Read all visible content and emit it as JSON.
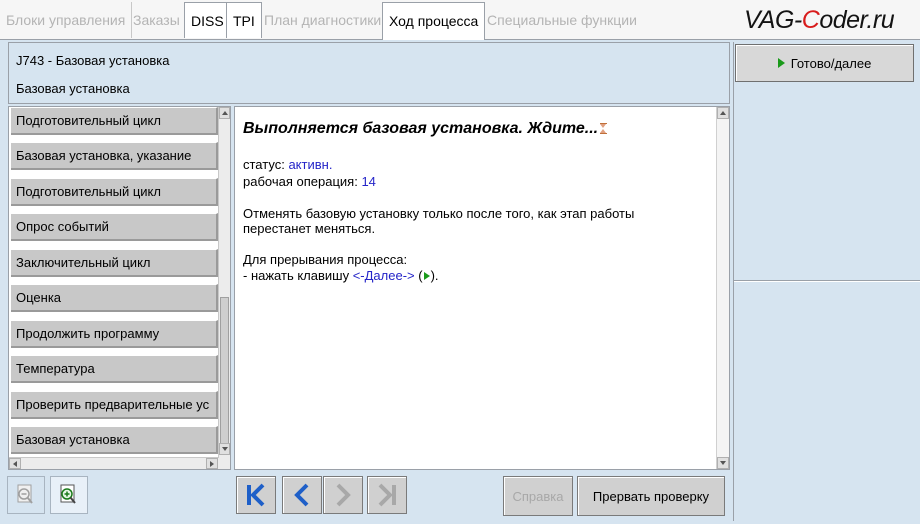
{
  "tabs": [
    {
      "label": "Блоки управления",
      "enabled": false
    },
    {
      "label": "Заказы",
      "enabled": false
    },
    {
      "label": "DISS",
      "enabled": true
    },
    {
      "label": "TPI",
      "enabled": true
    },
    {
      "label": "План диагностики",
      "enabled": false
    },
    {
      "label": "Ход процесса",
      "enabled": true,
      "active": true
    },
    {
      "label": "Специальные функции",
      "enabled": false
    }
  ],
  "brand": {
    "pre": "VAG-",
    "highlight": "C",
    "post": "oder.ru"
  },
  "header": {
    "line1": "J743 - Базовая установка",
    "line2": "Базовая установка"
  },
  "right_panel": {
    "ready_label": "Готово/далее"
  },
  "list": {
    "items": [
      "Подготовительный цикл",
      "Базовая установка, указание",
      "Подготовительный цикл",
      "Опрос событий",
      "Заключительный цикл",
      "Оценка",
      "Продолжить программу",
      "Температура",
      "Проверить предварительные ус",
      "Базовая установка"
    ]
  },
  "content": {
    "title": "Выполняется базовая установка. Ждите...",
    "status_label": "статус:",
    "status_value": "активн.",
    "op_label": "рабочая операция:",
    "op_value": "14",
    "warning_line1": "Отменять базовую установку только после того, как этап работы",
    "warning_line2": "перестанет меняться.",
    "interrupt_line1": "Для прерывания процесса:",
    "interrupt_prefix": "- нажать клавишу",
    "interrupt_key": "<-Далее->",
    "interrupt_open": "(",
    "interrupt_close": ")."
  },
  "toolbar": {
    "help_label": "Справка",
    "abort_label": "Прервать проверку"
  },
  "colors": {
    "panel_bg": "#d6e4f0",
    "accent_blue": "#1e5fc8",
    "play_green": "#1a9a1a",
    "link_blue": "#2424c8"
  }
}
